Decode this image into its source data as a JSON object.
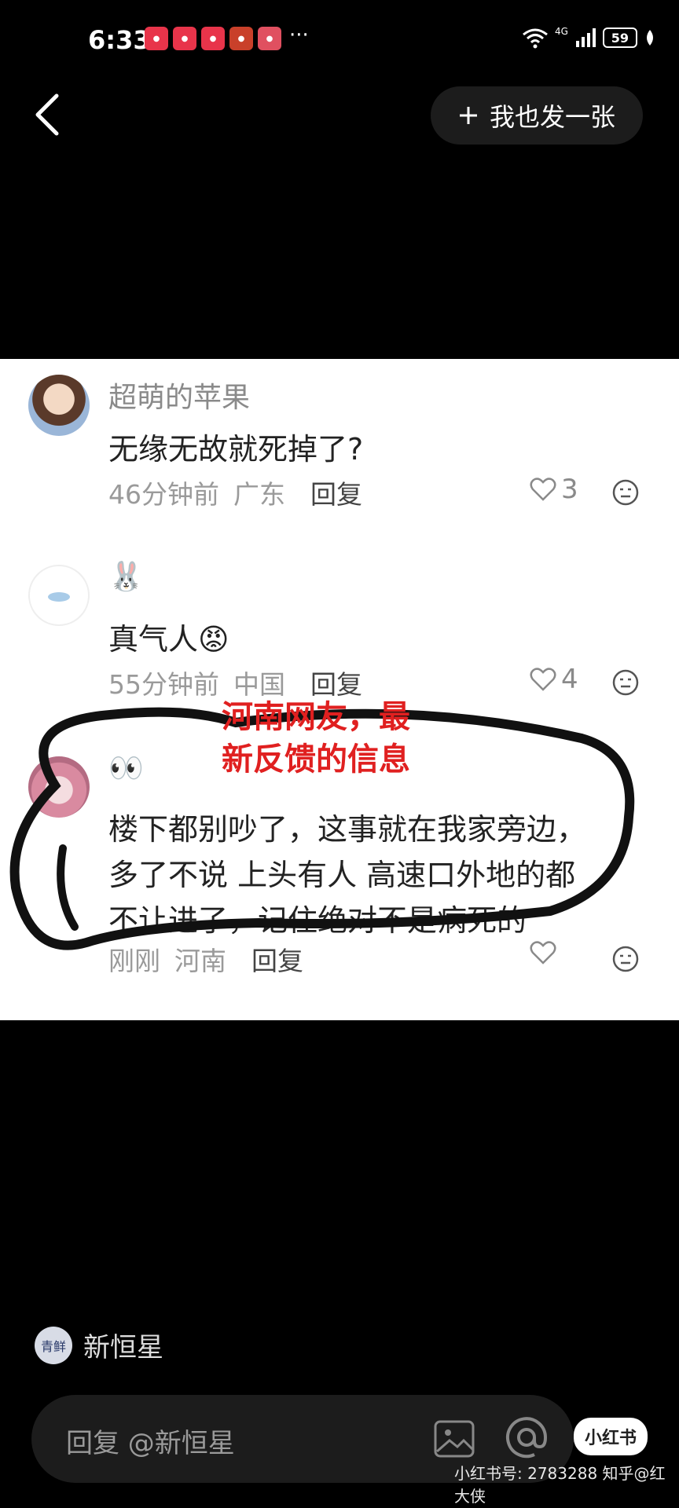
{
  "status_bar": {
    "time": "6:33",
    "more": "···",
    "network": "4G",
    "battery": "59",
    "app_icons": [
      "app-icon",
      "app-icon",
      "app-icon",
      "app-icon",
      "app-icon"
    ]
  },
  "header": {
    "post_button_label": "我也发一张",
    "back_icon": "chevron-left-icon"
  },
  "comments": [
    {
      "user": "超萌的苹果",
      "text": "无缘无故就死掉了?",
      "time": "46分钟前",
      "location": "广东",
      "reply_label": "回复",
      "likes": "3"
    },
    {
      "user": "🐰",
      "text": "真气人😡",
      "time": "55分钟前",
      "location": "中国",
      "reply_label": "回复",
      "likes": "4"
    },
    {
      "user": "👀",
      "text_lines": [
        "楼下都别吵了，这事就在我家旁边，",
        "多了不说 上头有人 高速口外地的都",
        "不让进了，记住绝对不是病死的"
      ],
      "time": "刚刚",
      "location": "河南",
      "reply_label": "回复",
      "likes": ""
    }
  ],
  "annotation": {
    "line1": "河南网友，最",
    "line2": "新反馈的信息",
    "color": "#e02020"
  },
  "footer": {
    "author_name": "新恒星",
    "author_avatar_text": "青鲜",
    "reply_placeholder": "回复 @新恒星",
    "logo": "小红书",
    "watermark": "小红书号: 2783288 知乎@红大侠"
  }
}
